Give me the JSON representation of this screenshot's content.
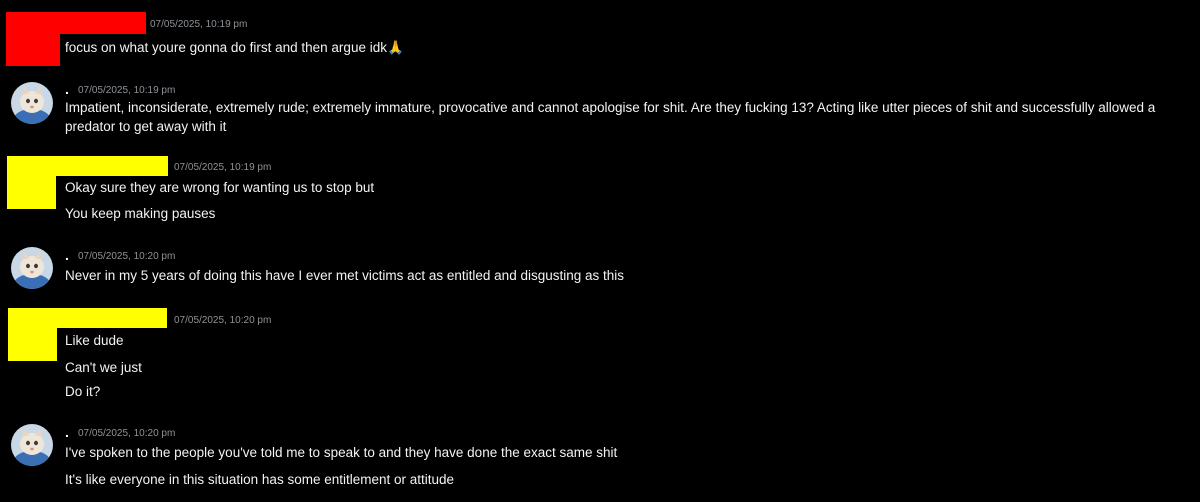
{
  "colors": {
    "background": "#000000",
    "timestamp": "#8e9297",
    "message_text": "#f2f3f5",
    "redact_red": "#ff0000",
    "redact_yellow": "#ffff00"
  },
  "messages": [
    {
      "author": "",
      "author_redacted": true,
      "redaction_color": "red",
      "timestamp": "07/05/2025, 10:19 pm",
      "lines": [
        "focus on what youre gonna do first and then argue idk🙏"
      ]
    },
    {
      "author": ".",
      "author_redacted": false,
      "avatar_icon": "cat-avatar-icon",
      "timestamp": "07/05/2025, 10:19 pm",
      "lines": [
        "Impatient, inconsiderate, extremely rude; extremely immature, provocative and cannot apologise for shit. Are they fucking 13? Acting like utter pieces of shit and successfully allowed a predator to get away with it"
      ]
    },
    {
      "author": "",
      "author_redacted": true,
      "redaction_color": "yellow",
      "timestamp": "07/05/2025, 10:19 pm",
      "lines": [
        "Okay sure they are wrong for wanting us to stop but",
        "You keep making pauses"
      ]
    },
    {
      "author": ".",
      "author_redacted": false,
      "avatar_icon": "cat-avatar-icon",
      "timestamp": "07/05/2025, 10:20 pm",
      "lines": [
        "Never in my 5 years of doing this have I ever met victims act as entitled and disgusting as this"
      ]
    },
    {
      "author": "",
      "author_redacted": true,
      "redaction_color": "yellow",
      "timestamp": "07/05/2025, 10:20 pm",
      "lines": [
        "Like dude",
        "Can't we just",
        "Do it?"
      ]
    },
    {
      "author": ".",
      "author_redacted": false,
      "avatar_icon": "cat-avatar-icon",
      "timestamp": "07/05/2025, 10:20 pm",
      "lines": [
        "I've spoken to the people you've told me to speak to and they have done the exact same shit",
        "It's like everyone in this situation has some entitlement or attitude"
      ]
    }
  ]
}
